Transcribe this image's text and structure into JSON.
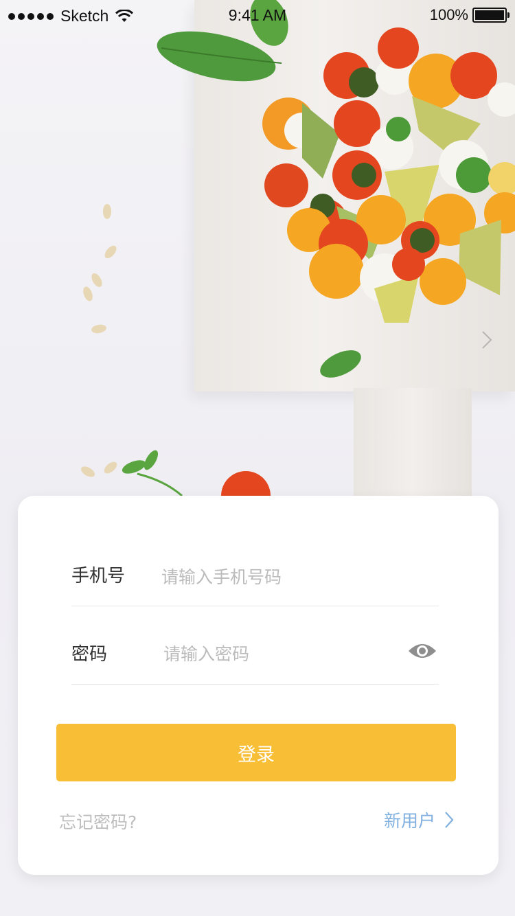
{
  "status_bar": {
    "carrier": "Sketch",
    "time": "9:41 AM",
    "battery": "100%"
  },
  "login": {
    "phone_label": "手机号",
    "phone_placeholder": "请输入手机号码",
    "password_label": "密码",
    "password_placeholder": "请输入密码",
    "login_button": "登录",
    "forgot_password": "忘记密码?",
    "new_user": "新用户"
  },
  "colors": {
    "accent": "#f8bf36",
    "link": "#7fb0e0",
    "muted_text": "#bdbdbd"
  },
  "icons": {
    "password_toggle": "eye-icon",
    "new_user_arrow": "chevron-right-icon",
    "carousel_next": "chevron-right-icon"
  }
}
